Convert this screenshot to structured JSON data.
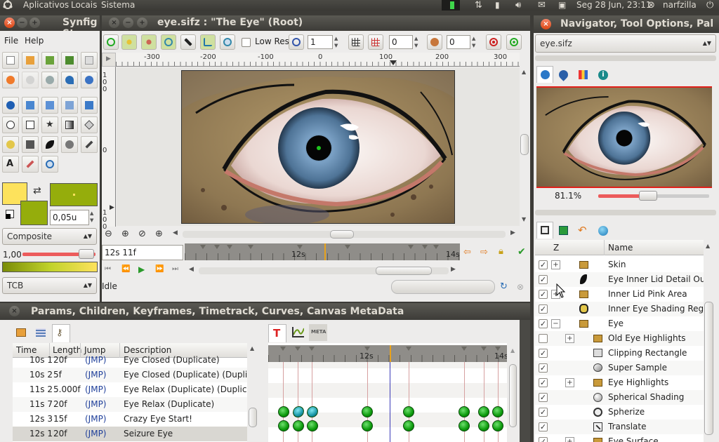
{
  "top_panel": {
    "menus": [
      "Aplicativos",
      "Locais",
      "Sistema"
    ],
    "clock": "Seg 28 Jun, 23:11",
    "user": "narfzilla"
  },
  "toolbox": {
    "title": "Synfig St",
    "menu": [
      "File",
      "Help"
    ],
    "width_value": "0,05u",
    "blend_mode": "Composite",
    "opacity_value": "1,00",
    "interpolation": "TCB",
    "fill_color": "#95ad0c",
    "outline_color": "#fde25c"
  },
  "canvas_window": {
    "title": "eye.sifz : \"The Eye\" (Root)",
    "low_res_label": "Low Res",
    "spin1": "1",
    "spin2": "0",
    "spin3": "0",
    "ruler_labels": [
      "-300",
      "-200",
      "-100",
      "0",
      "100",
      "200",
      "300"
    ],
    "vruler_labels": [
      "100",
      "0",
      "100"
    ],
    "time_field": "12s 11f",
    "timebar_labels": [
      "12s",
      "14s"
    ],
    "status": "Idle"
  },
  "navigator": {
    "title": "Navigator, Tool Options, Pal",
    "file": "eye.sifz",
    "zoom": "81.1%"
  },
  "layers": {
    "col_z": "Z",
    "col_name": "Name",
    "rows": [
      {
        "name": "Skin",
        "checked": true,
        "expander": "+",
        "indent": 0,
        "icon": "folder"
      },
      {
        "name": "Eye Inner Lid Detail Outlin",
        "checked": true,
        "expander": "",
        "indent": 0,
        "icon": "outline"
      },
      {
        "name": "Inner Lid Pink Area",
        "checked": true,
        "expander": "+",
        "indent": 0,
        "icon": "folder"
      },
      {
        "name": "Inner Eye Shading Region",
        "checked": true,
        "expander": "",
        "indent": 0,
        "icon": "region"
      },
      {
        "name": "Eye",
        "checked": true,
        "expander": "−",
        "indent": 0,
        "icon": "folder"
      },
      {
        "name": "Old Eye Highlights",
        "checked": false,
        "expander": "+",
        "indent": 1,
        "icon": "folder"
      },
      {
        "name": "Clipping Rectangle",
        "checked": true,
        "expander": "",
        "indent": 1,
        "icon": "rect"
      },
      {
        "name": "Super Sample",
        "checked": true,
        "expander": "",
        "indent": 1,
        "icon": "supersample"
      },
      {
        "name": "Eye Highlights",
        "checked": true,
        "expander": "+",
        "indent": 1,
        "icon": "folder"
      },
      {
        "name": "Spherical Shading",
        "checked": true,
        "expander": "",
        "indent": 1,
        "icon": "circle"
      },
      {
        "name": "Spherize",
        "checked": true,
        "expander": "",
        "indent": 1,
        "icon": "spherize"
      },
      {
        "name": "Translate",
        "checked": true,
        "expander": "",
        "indent": 1,
        "icon": "translate"
      },
      {
        "name": "Eye Surface",
        "checked": true,
        "expander": "+",
        "indent": 1,
        "icon": "folder"
      }
    ]
  },
  "params_panel": {
    "title": "Params, Children, Keyframes, Timetrack, Curves, Canvas MetaData",
    "columns": [
      "Time",
      "Length",
      "Jump",
      "Description"
    ],
    "rows": [
      {
        "time": "10s 1",
        "length": "20f",
        "jump": "(JMP)",
        "desc": "Eye Closed (Duplicate)"
      },
      {
        "time": "10s 2",
        "length": "5f",
        "jump": "(JMP)",
        "desc": "Eye Closed (Duplicate) (Duplicate)"
      },
      {
        "time": "11s 2",
        "length": "5.000f",
        "jump": "(JMP)",
        "desc": "Eye Relax (Duplicate) (Duplicate)"
      },
      {
        "time": "11s 7",
        "length": "20f",
        "jump": "(JMP)",
        "desc": "Eye Relax (Duplicate)"
      },
      {
        "time": "12s 3",
        "length": "15f",
        "jump": "(JMP)",
        "desc": "Crazy Eye Start!"
      },
      {
        "time": "12s 1",
        "length": "20f",
        "jump": "(JMP)",
        "desc": "Seizure Eye"
      }
    ],
    "timetrack_labels": [
      "12s",
      "14s"
    ],
    "meta_label": "META"
  }
}
